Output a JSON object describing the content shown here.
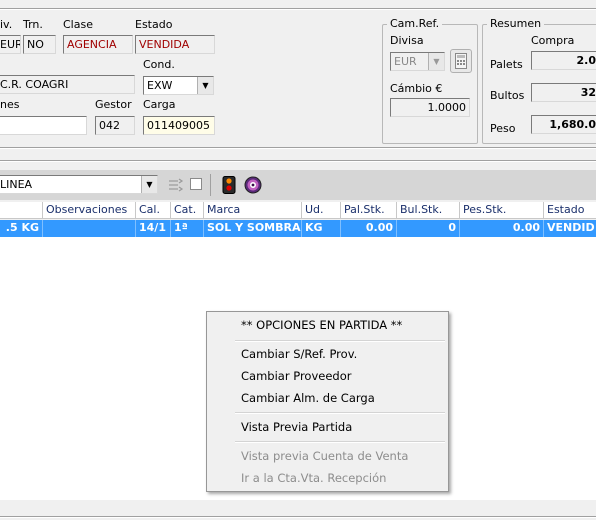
{
  "header": {
    "div_label": "iv.",
    "div_value": "EUR",
    "trn_label": "Trn.",
    "trn_value": "NO",
    "clase_label": "Clase",
    "clase_value": "AGENCIA",
    "estado_label": "Estado",
    "estado_value": "VENDIDA",
    "cliente_value": "C.R. COAGRI",
    "cond_label": "Cond.",
    "cond_value": "EXW",
    "obs_label": "nes",
    "obs_value": "",
    "gestor_label": "Gestor",
    "gestor_value": "042",
    "carga_label": "Carga",
    "carga_value": "011409005"
  },
  "camref": {
    "title": "Cam.Ref.",
    "divisa_label": "Divisa",
    "divisa_value": "EUR",
    "cambio_label": "Cámbio €",
    "cambio_value": "1.0000"
  },
  "resumen": {
    "title": "Resumen",
    "compra_label": "Compra",
    "palets_label": "Palets",
    "palets_value": "2.0",
    "bultos_label": "Bultos",
    "bultos_value": "32",
    "peso_label": "Peso",
    "peso_value": "1,680.0"
  },
  "toolbar": {
    "filter_value": "LINEA",
    "checkbox_checked": false
  },
  "grid": {
    "columns": [
      "Observaciones",
      "Cal.",
      "Cat.",
      "Marca",
      "Ud.",
      "Pal.Stk.",
      "Bul.Stk.",
      "Pes.Stk.",
      "Estado"
    ],
    "row": {
      "first": ".5 KG",
      "observaciones": "",
      "cal": "14/1",
      "cat": "1ª",
      "marca": "SOL Y SOMBRA",
      "ud": "KG",
      "pal_stk": "0.00",
      "bul_stk": "0",
      "pes_stk": "0.00",
      "estado": "VENDID"
    }
  },
  "context_menu": {
    "title": "** OPCIONES EN PARTIDA **",
    "items": [
      "Cambiar S/Ref. Prov.",
      "Cambiar Proveedor",
      "Cambiar Alm. de Carga",
      "Vista Previa Partida",
      "Vista previa Cuenta de Venta",
      "Ir a la Cta.Vta. Recepción"
    ]
  },
  "colors": {
    "selection": "#3399ff",
    "header_text": "#1a2f6b",
    "red_text": "#a00000"
  }
}
